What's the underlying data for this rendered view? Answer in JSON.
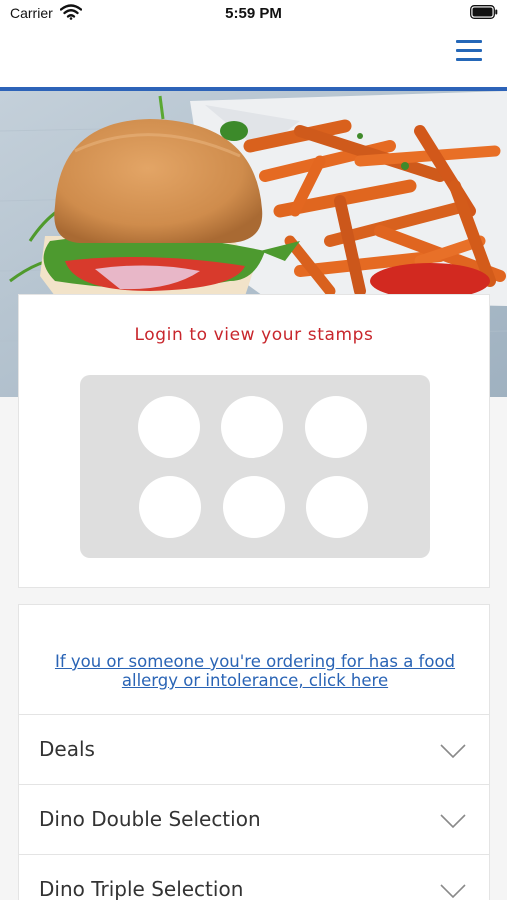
{
  "status_bar": {
    "carrier": "Carrier",
    "time": "5:59 PM"
  },
  "nav": {
    "menu_icon": "hamburger-icon"
  },
  "hero": {
    "image": "burger-and-sweet-potato-fries"
  },
  "stamp_card": {
    "title": "Login to view your stamps",
    "stamps_total": 6
  },
  "menu": {
    "allergy_link": "If you or someone you're ordering for has a food allergy or intolerance, click here",
    "sections": [
      {
        "label": "Deals"
      },
      {
        "label": "Dino Double Selection"
      },
      {
        "label": "Dino Triple Selection"
      }
    ]
  },
  "colors": {
    "accent_blue": "#2d63b8",
    "login_red": "#c8262c",
    "link_blue": "#2a64b5"
  }
}
